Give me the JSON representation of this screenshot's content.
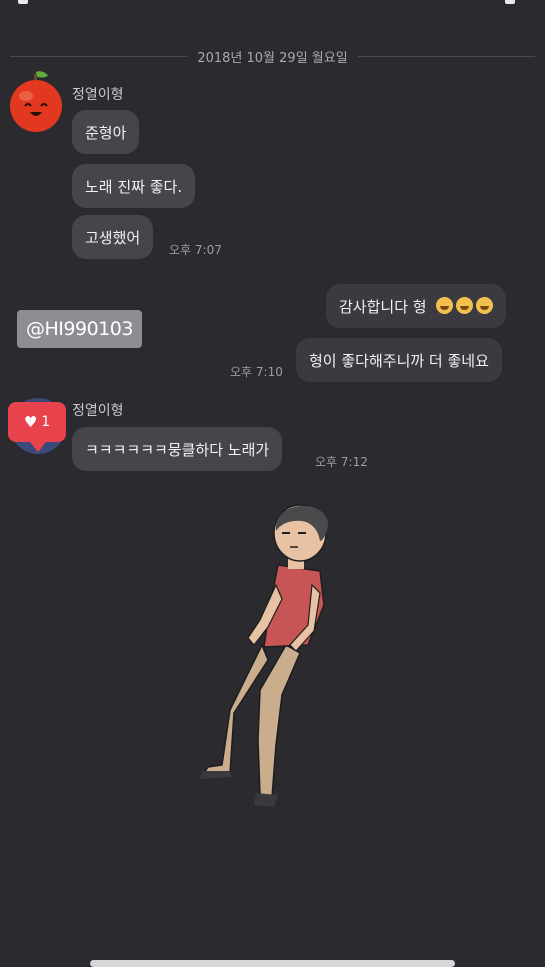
{
  "date_separator": "2018년 10월 29일 월요일",
  "messages": [
    {
      "sender": "정열이형",
      "lines": [
        "준형아",
        "노래 진짜 좋다.",
        "고생했어"
      ],
      "time": "오후 7:07"
    },
    {
      "mine": true,
      "lines": [
        "감사합니다 형",
        "형이 좋다해주니까 더 좋네요"
      ],
      "time": "오후 7:10"
    },
    {
      "sender": "정열이형",
      "lines": [
        "ㅋㅋㅋㅋㅋㅋ뭉클하다 노래가"
      ],
      "time": "오후 7:12",
      "reaction_count": "1"
    }
  ],
  "tag_sticker": "@HI990103",
  "icons": {
    "avatar": "apple-face-avatar-icon",
    "like": "heart-icon",
    "emoji": "rofl-emoji-icon",
    "sticker": "cartoon-man-sticker"
  },
  "colors": {
    "background": "#2b2b2f",
    "bubble": "#45454b",
    "like_badge": "#e8434c"
  }
}
